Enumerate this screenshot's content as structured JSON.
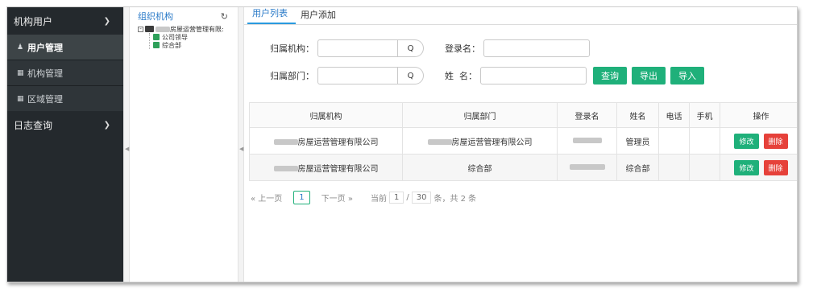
{
  "sidebar": {
    "group1": "机构用户",
    "items": [
      {
        "label": "用户管理",
        "icon": "user-icon"
      },
      {
        "label": "机构管理",
        "icon": "grid-icon"
      },
      {
        "label": "区域管理",
        "icon": "grid-icon"
      }
    ],
    "group2": "日志查询"
  },
  "tree": {
    "title": "组织机构",
    "root": "房屋运营管理有限:",
    "children": [
      "公司领导",
      "综合部"
    ]
  },
  "tabs": [
    "用户列表",
    "用户添加"
  ],
  "form": {
    "org_label": "归属机构：",
    "dept_label": "归属部门：",
    "login_label": "登录名：",
    "name_label": "姓  名：",
    "query_btn": "查询",
    "export_btn": "导出",
    "import_btn": "导入"
  },
  "table": {
    "headers": [
      "归属机构",
      "归属部门",
      "登录名",
      "姓名",
      "电话",
      "手机",
      "操作"
    ],
    "rows": [
      {
        "org": "房屋运营管理有限公司",
        "dept": "房屋运营管理有限公司",
        "name": "管理员"
      },
      {
        "org": "房屋运营管理有限公司",
        "dept": "综合部",
        "name": "综合部"
      }
    ],
    "edit_label": "修改",
    "delete_label": "删除"
  },
  "pager": {
    "prev": "« 上一页",
    "current": "1",
    "next": "下一页 »",
    "info_pre": "当前",
    "page": "1",
    "sep": "/",
    "size": "30",
    "info_post": "条，共 2 条"
  },
  "colors": {
    "sidebar_bg": "#24292d",
    "accent_green": "#1fb07a",
    "accent_red": "#e6413a",
    "link_blue": "#2a7ac8"
  }
}
